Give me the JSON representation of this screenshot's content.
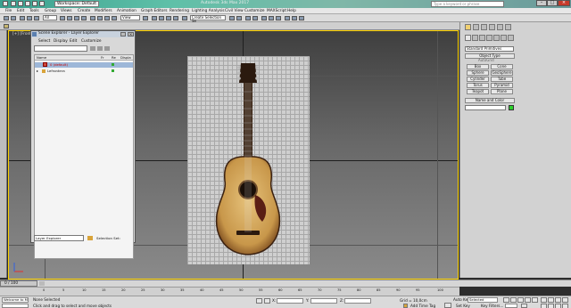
{
  "window": {
    "workspace": "Workspace: Default",
    "app_title": "Autodesk 3ds Max 2017",
    "search_placeholder": "Type a keyword or phrase",
    "signin": "Sign In"
  },
  "menu": [
    "File",
    "Edit",
    "Tools",
    "Group",
    "Views",
    "Create",
    "Modifiers",
    "Animation",
    "Graph Editors",
    "Rendering",
    "Lighting Analysis",
    "Civil View",
    "Customize",
    "MAXScript",
    "Help"
  ],
  "toolbar": {
    "filter_dropdown": "All",
    "view_dropdown": "View",
    "selection_set": "Create Selection Se"
  },
  "viewport": {
    "label": "[+] [Front] [Standard] [Default Shading]"
  },
  "scene_explorer": {
    "title": "Scene Explorer - Layer Explorer",
    "menu": [
      "Select",
      "Display",
      "Edit",
      "Customize"
    ],
    "columns": [
      "Name",
      "Fr",
      "Re",
      "Displa"
    ],
    "rows": [
      {
        "name": "0 (default)",
        "selected": true
      },
      {
        "name": "Lefrontera",
        "selected": false
      }
    ],
    "explorer_dropdown": "Layer Explorer",
    "selection_set_label": "Selection Set:"
  },
  "command_panel": {
    "category_dropdown": "Standard Primitives",
    "object_type_header": "Object Type",
    "autogrid_label": "AutoGrid",
    "buttons": [
      "Box",
      "Cone",
      "Sphere",
      "GeoSphere",
      "Cylinder",
      "Tube",
      "Torus",
      "Pyramid",
      "Teapot",
      "Plane"
    ],
    "name_color_header": "Name and Color",
    "object_color": "#2bd12b"
  },
  "timeline": {
    "frame_readout": "0 / 100",
    "ticks": [
      "0",
      "5",
      "10",
      "15",
      "20",
      "25",
      "30",
      "35",
      "40",
      "45",
      "50",
      "55",
      "60",
      "65",
      "70",
      "75",
      "80",
      "85",
      "90",
      "95",
      "100"
    ]
  },
  "status": {
    "maxscript": "Welcome to M",
    "selection": "None Selected",
    "prompt": "Click and drag to select and move objects",
    "x_label": "X:",
    "y_label": "Y:",
    "z_label": "Z:",
    "grid": "Grid = 10,0cm",
    "add_time_tag": "Add Time Tag",
    "auto_key": "Auto Key",
    "auto_key_dropdown": "Selected",
    "set_key": "Set Key",
    "key_filters": "Key Filters..."
  }
}
